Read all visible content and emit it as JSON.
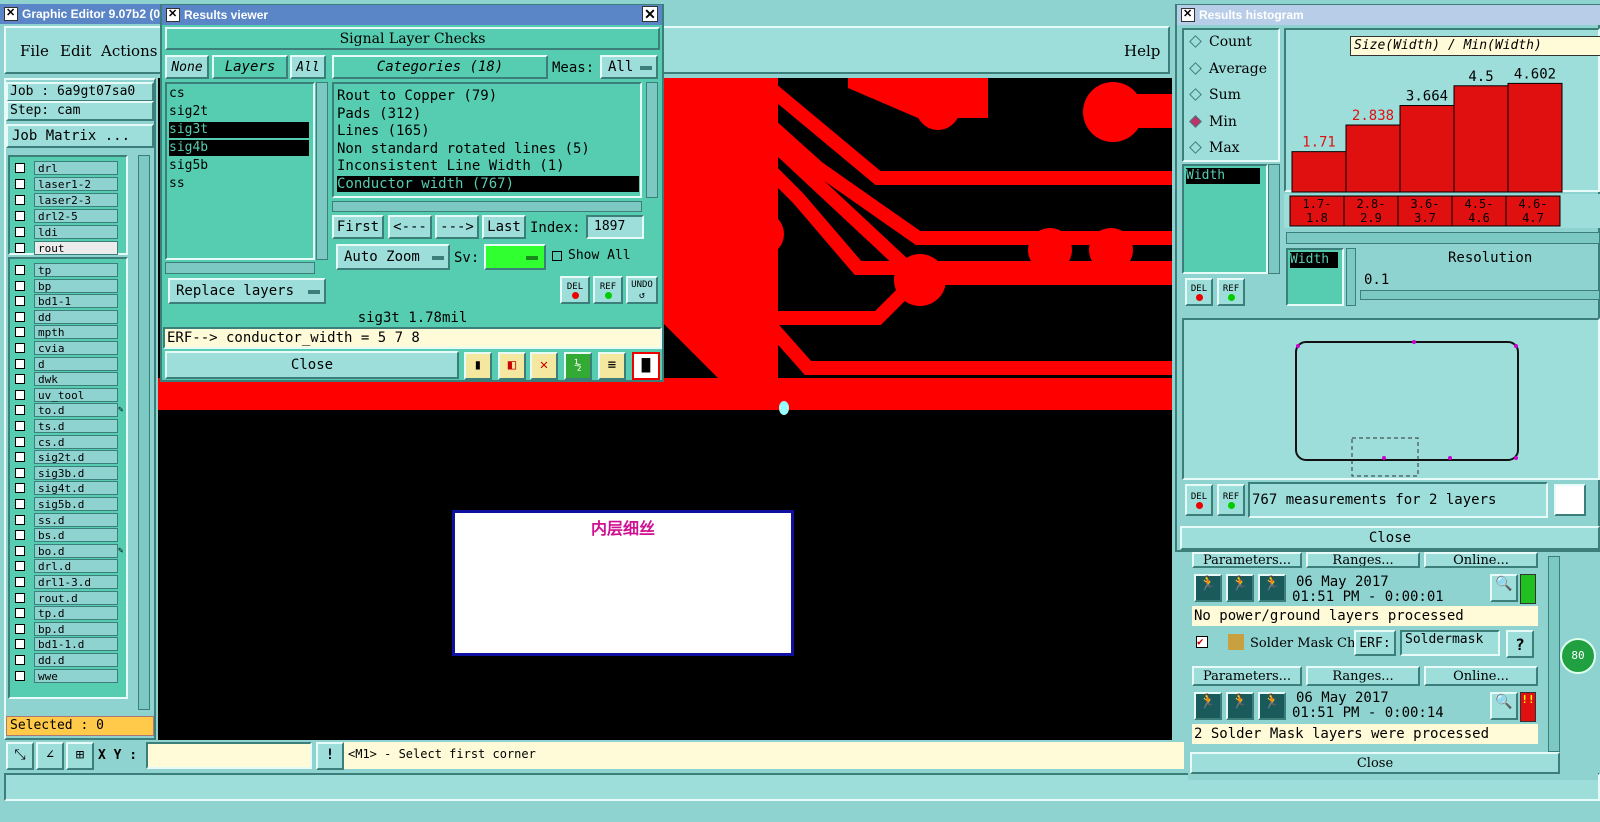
{
  "main": {
    "title": "Graphic Editor 9.07b2 (0",
    "menu": [
      "File",
      "Edit",
      "Actions"
    ],
    "help": "Help",
    "job": "Job : 6a9gt07sa0",
    "step": "Step: cam",
    "job_matrix": "Job Matrix ...",
    "layers_top": [
      "drl",
      "laser1-2",
      "laser2-3",
      "drl2-5",
      "ldi",
      "rout"
    ],
    "layers": [
      "tp",
      "bp",
      "bd1-1",
      "dd",
      "mpth",
      "cvia",
      "d",
      "dwk",
      "uv_tool",
      "to.d",
      "ts.d",
      "cs.d",
      "sig2t.d",
      "sig3b.d",
      "sig4t.d",
      "sig5b.d",
      "ss.d",
      "bs.d",
      "bo.d",
      "drl.d",
      "drl1-3.d",
      "rout.d",
      "tp.d",
      "bp.d",
      "bd1-1.d",
      "dd.d",
      "wwe"
    ],
    "selected": "Selected : 0",
    "xy_label": "X Y :",
    "xy_value": "",
    "status": "<M1> - Select first corner",
    "canvas_label": "内层细丝",
    "colors": {
      "bg": "#8fd3d0",
      "canvas": "#000000",
      "copper": "#ff0000",
      "panel": "#56ccb0",
      "title": "#5a85c6"
    }
  },
  "results_viewer": {
    "title": "Results viewer",
    "header": "Signal Layer Checks",
    "none": "None",
    "layers": "Layers",
    "all": "All",
    "categories": "Categories (18)",
    "meas_label": "Meas:",
    "meas_value": "All",
    "layer_list": [
      "cs",
      "sig2t",
      "sig3t",
      "sig4b",
      "sig5b",
      "ss"
    ],
    "cat_list": [
      "Rout to Copper (79)",
      "Pads (312)",
      "Lines (165)",
      "Non standard rotated lines (5)",
      "Inconsistent Line Width (1)",
      "Conductor width (767)"
    ],
    "first": "First",
    "prev": "<---",
    "next": "--->",
    "last": "Last",
    "index_label": "Index:",
    "index_value": "1897",
    "auto_zoom": "Auto Zoom",
    "sv": "Sv:",
    "show_all": "Show All",
    "replace_layers": "Replace layers",
    "del": "DEL",
    "ref": "REF",
    "undo": "UNDO",
    "info": "sig3t 1.78mil",
    "erf": "ERF--> conductor_width = 5 7 8",
    "close": "Close"
  },
  "histogram": {
    "title": "Results histogram",
    "stats": [
      "Count",
      "Average",
      "Sum",
      "Min",
      "Max"
    ],
    "selected_stat": "Min",
    "axis_title": "Size(Width) / Min(Width)",
    "field": "Width",
    "bars": [
      {
        "label": "1.71",
        "range": "1.7-\n1.8",
        "value": 1.71
      },
      {
        "label": "2.838",
        "range": "2.8-\n2.9",
        "value": 2.838
      },
      {
        "label": "3.664",
        "range": "3.6-\n3.7",
        "value": 3.664
      },
      {
        "label": "4.5",
        "range": "4.5-\n4.6",
        "value": 4.5
      },
      {
        "label": "4.602",
        "range": "4.6-\n4.7",
        "value": 4.602
      }
    ],
    "resolution_label": "Resolution",
    "resolution_value": "0.1",
    "width_label": "Width",
    "summary": "767 measurements for 2 layers",
    "close": "Close"
  },
  "checklist": {
    "params": "Parameters...",
    "ranges": "Ranges...",
    "online": "Online...",
    "date1": "06 May 2017",
    "time1": "01:51 PM - 0:00:01",
    "msg1": "No power/ground layers processed",
    "solder": "Solder Mask Ch",
    "erf": "ERF:",
    "erf_value": "Soldermask",
    "help_q": "?",
    "date2": "06 May 2017",
    "time2": "01:51 PM - 0:00:14",
    "msg2": "2 Solder Mask layers were processed",
    "close": "Close",
    "percent": "80"
  }
}
